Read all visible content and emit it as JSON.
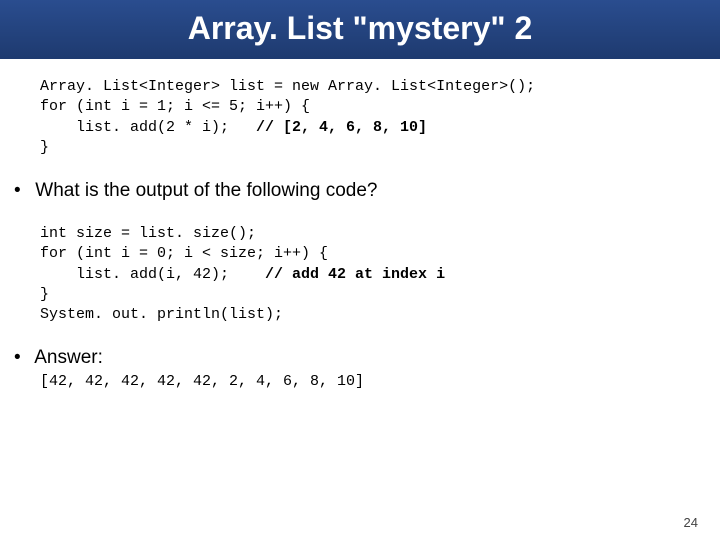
{
  "title": "Array. List \"mystery\" 2",
  "code1": {
    "line1": "Array. List<Integer> list = new Array. List<Integer>();",
    "line2": "for (int i = 1; i <= 5; i++) {",
    "line3a": "    list. add(2 * i);",
    "line3b": "   // [2, 4, 6, 8, 10]",
    "line4": "}"
  },
  "question_bullet": "•",
  "question_text": " What is the output of the following code?",
  "code2": {
    "line1": "int size = list. size();",
    "line2": "for (int i = 0; i < size; i++) {",
    "line3a": "    list. add(i, 42);",
    "line3b": "    // add 42 at index i",
    "line4": "}",
    "line5": "System. out. println(list);"
  },
  "answer_bullet": "•",
  "answer_label": " Answer:",
  "answer_value": "[42, 42, 42, 42, 42, 2, 4, 6, 8, 10]",
  "page_number": "24"
}
